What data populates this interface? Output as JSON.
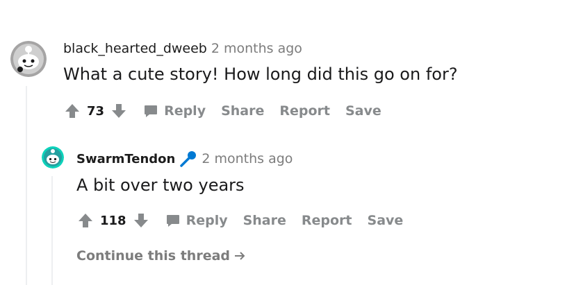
{
  "comments": [
    {
      "author": "black_hearted_dweeb",
      "time": "2 months ago",
      "body": "What a cute story! How long did this go on for?",
      "score": "73",
      "actions": {
        "reply": "Reply",
        "share": "Share",
        "report": "Report",
        "save": "Save"
      },
      "avatar_icon": "snoo-avatar-icon"
    },
    {
      "author": "SwarmTendon",
      "time": "2 months ago",
      "body": "A bit over two years",
      "score": "118",
      "actions": {
        "reply": "Reply",
        "share": "Share",
        "report": "Report",
        "save": "Save"
      },
      "avatar_icon": "snoo-avatar-icon",
      "flair_icon": "microphone-icon"
    }
  ],
  "continue_thread": "Continue this thread",
  "colors": {
    "action_gray": "#878a8c",
    "accent_blue": "#0079d3",
    "thread_line": "#edeff1",
    "avatar_teal": "#0dd3bb"
  }
}
